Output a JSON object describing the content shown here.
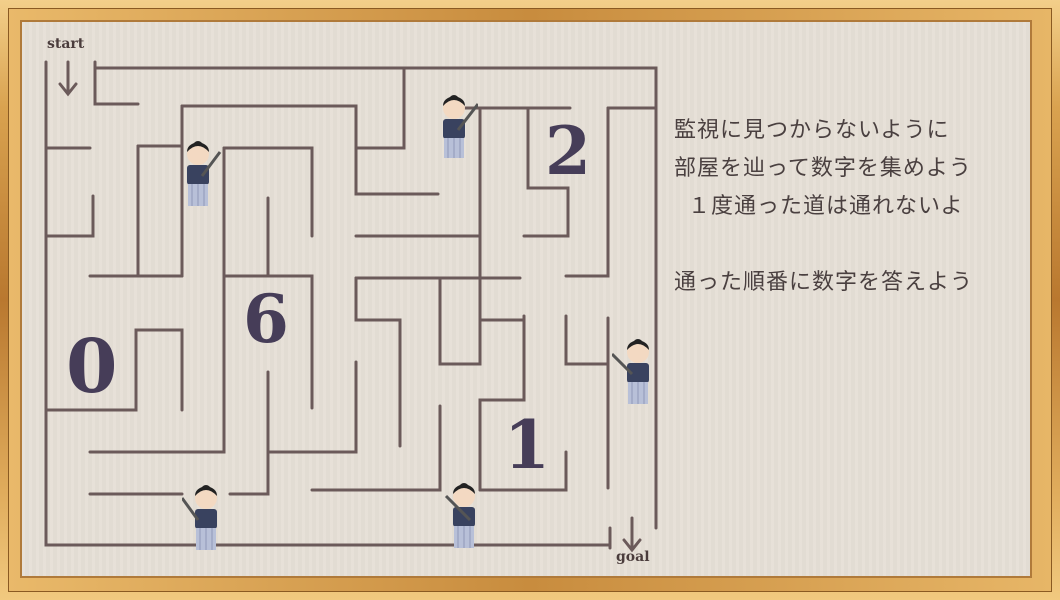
{
  "labels": {
    "start": "start",
    "goal": "goal"
  },
  "numbers": {
    "zero": "0",
    "six": "6",
    "two": "2",
    "one": "1"
  },
  "instructions": {
    "line1": "監視に見つからないように",
    "line2": "部屋を辿って数字を集めよう",
    "line3": "１度通った道は通れないよ",
    "line4": "通った順番に数字を答えよう"
  },
  "colors": {
    "wall": "#6b5a5a",
    "digit": "#463d58",
    "board": "#e6dfd6",
    "frame": "#c9974a"
  },
  "icons": [
    "start-arrow-icon",
    "goal-arrow-icon",
    "samurai-guard-icon"
  ]
}
